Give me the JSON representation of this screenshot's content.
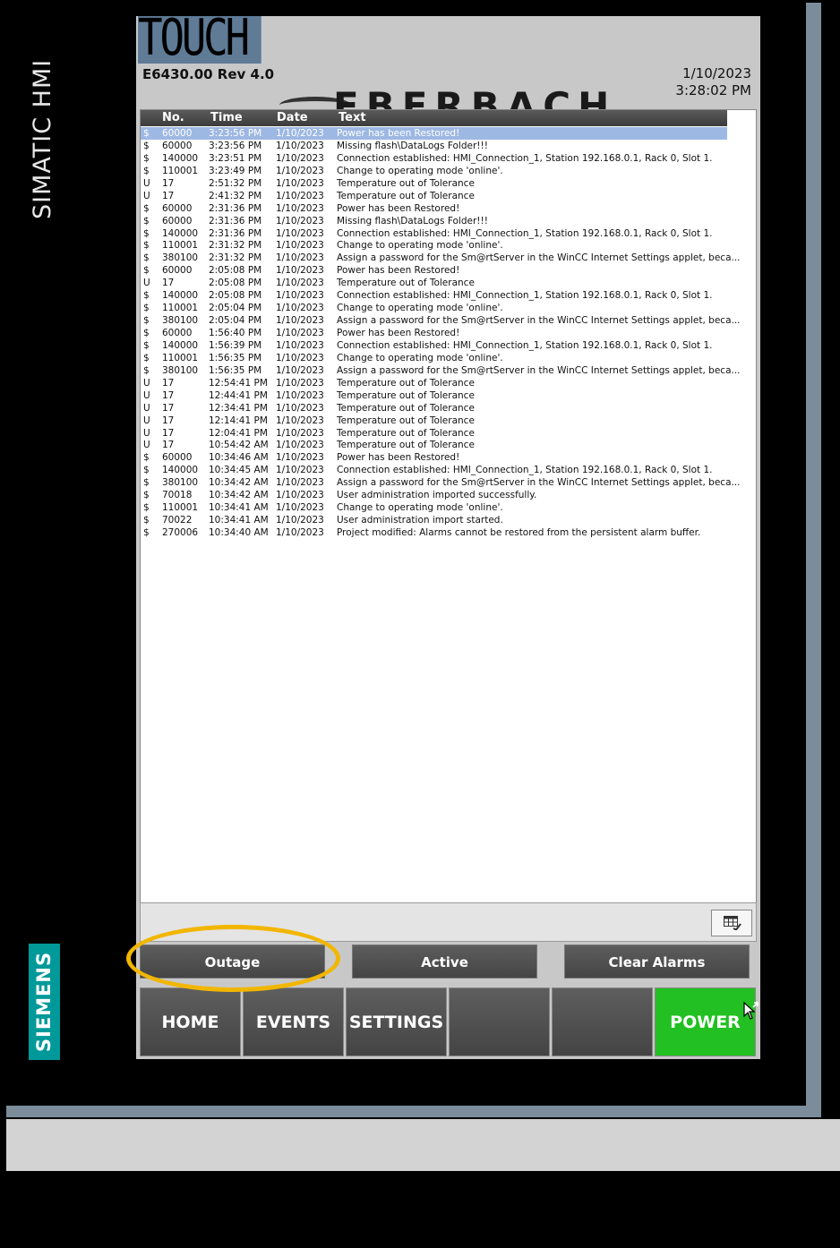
{
  "device": {
    "side_label": "SIMATIC HMI",
    "manufacturer": "SIEMENS"
  },
  "header": {
    "logo": "TOUCH",
    "model": "E6430.00 Rev 4.0",
    "date": "1/10/2023",
    "time": "3:28:02 PM",
    "brand_partial": "EBERBACH"
  },
  "alarm_table": {
    "columns": [
      "No.",
      "Time",
      "Date",
      "Text"
    ],
    "rows": [
      {
        "state": "$",
        "no": "60000",
        "time": "3:23:56 PM",
        "date": "1/10/2023",
        "text": "Power has been Restored!",
        "selected": true
      },
      {
        "state": "$",
        "no": "60000",
        "time": "3:23:56 PM",
        "date": "1/10/2023",
        "text": "Missing flash\\DataLogs Folder!!!"
      },
      {
        "state": "$",
        "no": "140000",
        "time": "3:23:51 PM",
        "date": "1/10/2023",
        "text": "Connection established: HMI_Connection_1, Station 192.168.0.1, Rack 0, Slot 1."
      },
      {
        "state": "$",
        "no": "110001",
        "time": "3:23:49 PM",
        "date": "1/10/2023",
        "text": "Change to operating mode 'online'."
      },
      {
        "state": "U",
        "no": "17",
        "time": "2:51:32 PM",
        "date": "1/10/2023",
        "text": "Temperature out of Tolerance"
      },
      {
        "state": "U",
        "no": "17",
        "time": "2:41:32 PM",
        "date": "1/10/2023",
        "text": "Temperature out of Tolerance"
      },
      {
        "state": "$",
        "no": "60000",
        "time": "2:31:36 PM",
        "date": "1/10/2023",
        "text": "Power has been Restored!"
      },
      {
        "state": "$",
        "no": "60000",
        "time": "2:31:36 PM",
        "date": "1/10/2023",
        "text": "Missing flash\\DataLogs Folder!!!"
      },
      {
        "state": "$",
        "no": "140000",
        "time": "2:31:36 PM",
        "date": "1/10/2023",
        "text": "Connection established: HMI_Connection_1, Station 192.168.0.1, Rack 0, Slot 1."
      },
      {
        "state": "$",
        "no": "110001",
        "time": "2:31:32 PM",
        "date": "1/10/2023",
        "text": "Change to operating mode 'online'."
      },
      {
        "state": "$",
        "no": "380100",
        "time": "2:31:32 PM",
        "date": "1/10/2023",
        "text": "Assign a password for the Sm@rtServer in the WinCC Internet Settings applet, beca..."
      },
      {
        "state": "$",
        "no": "60000",
        "time": "2:05:08 PM",
        "date": "1/10/2023",
        "text": "Power has been Restored!"
      },
      {
        "state": "U",
        "no": "17",
        "time": "2:05:08 PM",
        "date": "1/10/2023",
        "text": "Temperature out of Tolerance"
      },
      {
        "state": "$",
        "no": "140000",
        "time": "2:05:08 PM",
        "date": "1/10/2023",
        "text": "Connection established: HMI_Connection_1, Station 192.168.0.1, Rack 0, Slot 1."
      },
      {
        "state": "$",
        "no": "110001",
        "time": "2:05:04 PM",
        "date": "1/10/2023",
        "text": "Change to operating mode 'online'."
      },
      {
        "state": "$",
        "no": "380100",
        "time": "2:05:04 PM",
        "date": "1/10/2023",
        "text": "Assign a password for the Sm@rtServer in the WinCC Internet Settings applet, beca..."
      },
      {
        "state": "$",
        "no": "60000",
        "time": "1:56:40 PM",
        "date": "1/10/2023",
        "text": "Power has been Restored!"
      },
      {
        "state": "$",
        "no": "140000",
        "time": "1:56:39 PM",
        "date": "1/10/2023",
        "text": "Connection established: HMI_Connection_1, Station 192.168.0.1, Rack 0, Slot 1."
      },
      {
        "state": "$",
        "no": "110001",
        "time": "1:56:35 PM",
        "date": "1/10/2023",
        "text": "Change to operating mode 'online'."
      },
      {
        "state": "$",
        "no": "380100",
        "time": "1:56:35 PM",
        "date": "1/10/2023",
        "text": "Assign a password for the Sm@rtServer in the WinCC Internet Settings applet, beca..."
      },
      {
        "state": "U",
        "no": "17",
        "time": "12:54:41 PM",
        "date": "1/10/2023",
        "text": "Temperature out of Tolerance"
      },
      {
        "state": "U",
        "no": "17",
        "time": "12:44:41 PM",
        "date": "1/10/2023",
        "text": "Temperature out of Tolerance"
      },
      {
        "state": "U",
        "no": "17",
        "time": "12:34:41 PM",
        "date": "1/10/2023",
        "text": "Temperature out of Tolerance"
      },
      {
        "state": "U",
        "no": "17",
        "time": "12:14:41 PM",
        "date": "1/10/2023",
        "text": "Temperature out of Tolerance"
      },
      {
        "state": "U",
        "no": "17",
        "time": "12:04:41 PM",
        "date": "1/10/2023",
        "text": "Temperature out of Tolerance"
      },
      {
        "state": "U",
        "no": "17",
        "time": "10:54:42 AM",
        "date": "1/10/2023",
        "text": "Temperature out of Tolerance"
      },
      {
        "state": "$",
        "no": "60000",
        "time": "10:34:46 AM",
        "date": "1/10/2023",
        "text": "Power has been Restored!"
      },
      {
        "state": "$",
        "no": "140000",
        "time": "10:34:45 AM",
        "date": "1/10/2023",
        "text": "Connection established: HMI_Connection_1, Station 192.168.0.1, Rack 0, Slot 1."
      },
      {
        "state": "$",
        "no": "380100",
        "time": "10:34:42 AM",
        "date": "1/10/2023",
        "text": "Assign a password for the Sm@rtServer in the WinCC Internet Settings applet, beca..."
      },
      {
        "state": "$",
        "no": "70018",
        "time": "10:34:42 AM",
        "date": "1/10/2023",
        "text": "User administration imported successfully."
      },
      {
        "state": "$",
        "no": "110001",
        "time": "10:34:41 AM",
        "date": "1/10/2023",
        "text": "Change to operating mode 'online'."
      },
      {
        "state": "$",
        "no": "70022",
        "time": "10:34:41 AM",
        "date": "1/10/2023",
        "text": "User administration import started."
      },
      {
        "state": "$",
        "no": "270006",
        "time": "10:34:40 AM",
        "date": "1/10/2023",
        "text": "Project modified: Alarms cannot be restored from the persistent alarm buffer."
      }
    ]
  },
  "toolbar": {
    "table_settings_icon": "table-edit-icon"
  },
  "alarm_buttons": [
    {
      "label": "Outage"
    },
    {
      "label": "Active"
    },
    {
      "label": "Clear Alarms"
    }
  ],
  "nav_buttons": [
    {
      "label": "HOME"
    },
    {
      "label": "EVENTS"
    },
    {
      "label": "SETTINGS"
    },
    {
      "label": ""
    },
    {
      "label": ""
    },
    {
      "label": "POWER"
    }
  ],
  "colors": {
    "power_button": "#22c022",
    "highlight": "#f2b600",
    "selected_row": "#9db8e2",
    "siemens_teal": "#009999"
  }
}
